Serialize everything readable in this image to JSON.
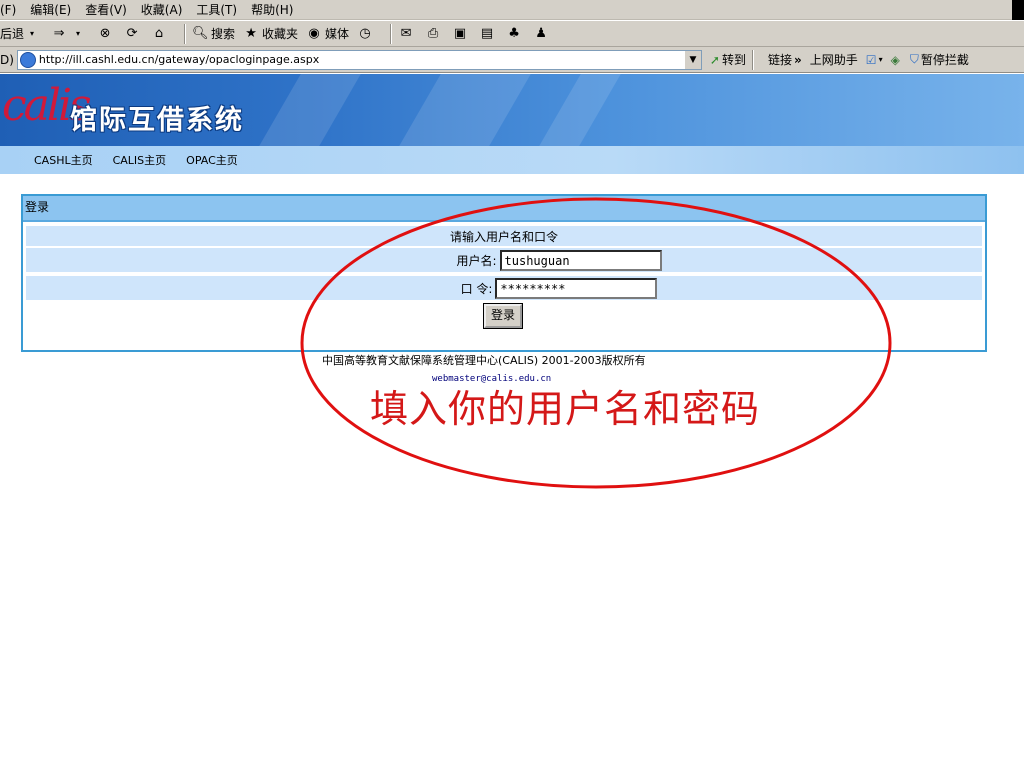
{
  "browser": {
    "menu": [
      "(F)",
      "编辑(E)",
      "查看(V)",
      "收藏(A)",
      "工具(T)",
      "帮助(H)"
    ],
    "toolbar": {
      "back": "后退",
      "search": "搜索",
      "favorites": "收藏夹",
      "media": "媒体"
    },
    "address": {
      "label": "D)",
      "url": "http://ill.cashl.edu.cn/gateway/opacloginpage.aspx",
      "go": "转到",
      "links": "链接",
      "helper": "上网助手",
      "popup_block": "暂停拦截"
    }
  },
  "site": {
    "logo_text": "calis",
    "title": "馆际互借系统",
    "nav": [
      "CASHL主页",
      "CALIS主页",
      "OPAC主页"
    ]
  },
  "login": {
    "panel_title": "登录",
    "prompt": "请输入用户名和口令",
    "username_label": "用户名:",
    "username_value": "tushuguan",
    "password_label": "口 令:",
    "password_value": "*********",
    "submit": "登录"
  },
  "footer": {
    "copyright": "中国高等教育文献保障系统管理中心(CALIS) 2001-2003版权所有",
    "email": "webmaster@calis.edu.cn"
  },
  "annotation": {
    "text": "填入你的用户名和密码",
    "color": "#d41818"
  }
}
